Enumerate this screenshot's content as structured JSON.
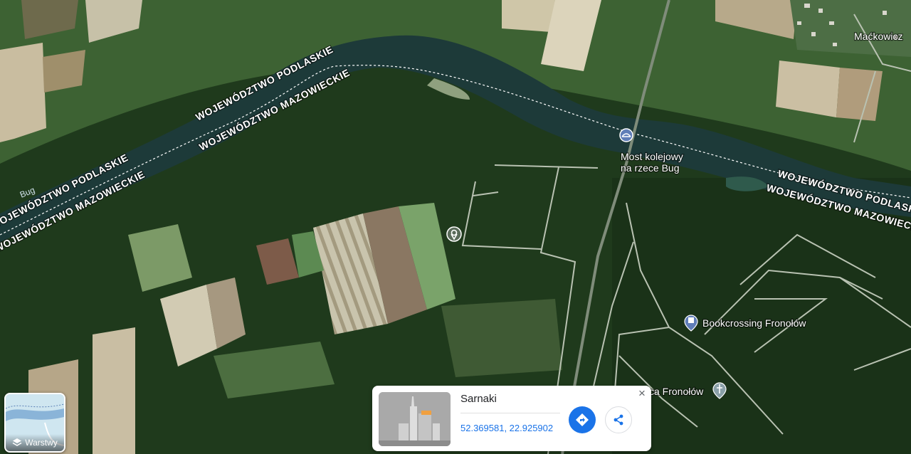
{
  "map": {
    "boundary_labels": {
      "podlaskie": "WOJEWÓDZTWO PODLASKIE",
      "mazowieckie": "WOJEWÓDZTWO MAZOWIECKIE"
    },
    "river_label": "Bug",
    "places": {
      "village": "Maćkowicz",
      "bridge": "Most kolejowy",
      "bridge_line2": "na rzece Bug",
      "bookcrossing": "Bookcrossing Fronołów",
      "fronolow_partial": "ca Fronołów"
    },
    "icons": {
      "bridge": "bridge-icon",
      "book": "book-icon",
      "selected": "location-pin-icon",
      "church": "church-icon"
    }
  },
  "layers": {
    "label": "Warstwy",
    "icon": "layers-icon"
  },
  "info_card": {
    "title": "Sarnaki",
    "coordinates": "52.369581, 22.925902",
    "icons": {
      "directions": "directions-icon",
      "share": "share-icon",
      "close": "close-icon"
    }
  },
  "colors": {
    "accent": "#1a73e8",
    "river": "#1d3a39",
    "forest": "#1f3a1c"
  }
}
